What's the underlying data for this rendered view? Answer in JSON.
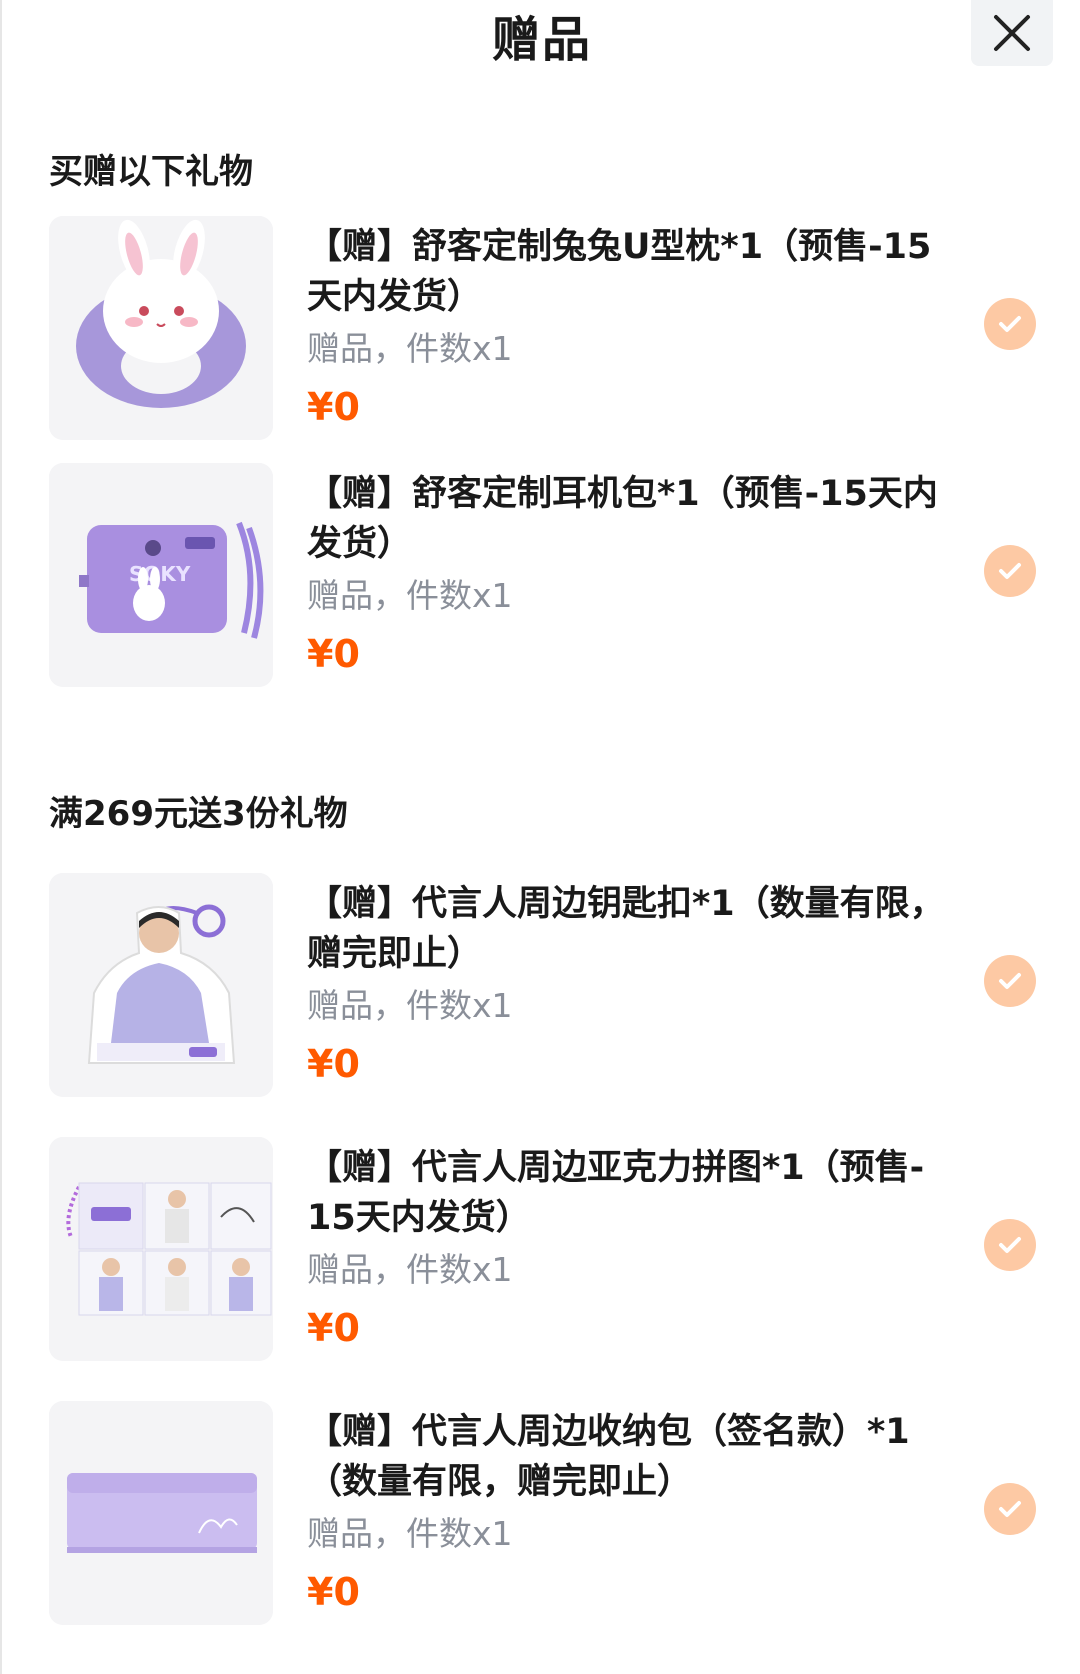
{
  "header": {
    "title": "赠品",
    "close_icon": "close-icon"
  },
  "sections": [
    {
      "title": "买赠以下礼物",
      "items": [
        {
          "name": "【赠】舒客定制兔兔U型枕*1（预售-15天内发货）",
          "meta": "赠品，件数x1",
          "price": "¥0",
          "image": "rabbit-u-pillow",
          "selected": true
        },
        {
          "name": "【赠】舒客定制耳机包*1（预售-15天内发货）",
          "meta": "赠品，件数x1",
          "price": "¥0",
          "image": "earphone-bag",
          "selected": true
        }
      ]
    },
    {
      "title": "满269元送3份礼物",
      "items": [
        {
          "name": "【赠】代言人周边钥匙扣*1（数量有限，赠完即止）",
          "meta": "赠品，件数x1",
          "price": "¥0",
          "image": "acrylic-keychain",
          "selected": true
        },
        {
          "name": "【赠】代言人周边亚克力拼图*1（预售-15天内发货）",
          "meta": "赠品，件数x1",
          "price": "¥0",
          "image": "acrylic-puzzle",
          "selected": true
        },
        {
          "name": "【赠】代言人周边收纳包（签名款）*1（数量有限，赠完即止）",
          "meta": "赠品，件数x1",
          "price": "¥0",
          "image": "storage-pouch",
          "selected": true
        }
      ]
    }
  ],
  "colors": {
    "price": "#ff5a00",
    "check": "#fdc9a4",
    "meta": "#8a8f99",
    "accent_purple": "#a897e0"
  }
}
